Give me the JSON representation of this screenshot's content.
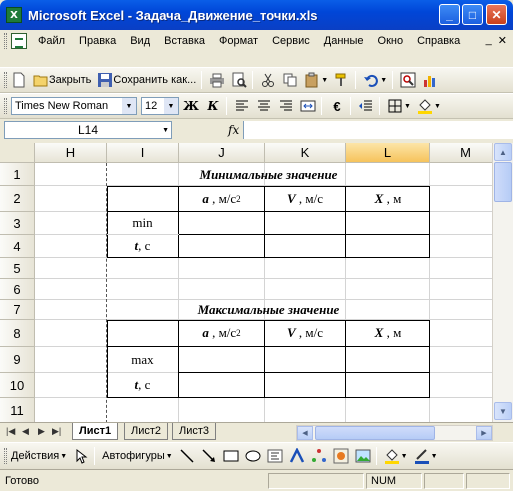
{
  "window": {
    "title": "Microsoft Excel - Задача_Движение_точки.xls",
    "app_icon_letter": "X",
    "minimize": "_",
    "maximize": "□",
    "close": "✕"
  },
  "menu": {
    "items": [
      "Файл",
      "Правка",
      "Вид",
      "Вставка",
      "Формат",
      "Сервис",
      "Данные",
      "Окно",
      "Справка"
    ],
    "doc_minimize": "_",
    "doc_close": "✕"
  },
  "toolbar_standard": {
    "close_label": "Закрыть",
    "save_as_label": "Сохранить как..."
  },
  "toolbar_format": {
    "font": "Times New Roman",
    "size": "12",
    "bold": "Ж",
    "italic": "К",
    "currency": "€"
  },
  "formula_bar": {
    "name_box": "L14",
    "fx": "fx",
    "value": ""
  },
  "sheet": {
    "columns": [
      "H",
      "I",
      "J",
      "K",
      "L",
      "M"
    ],
    "selected_column": "L",
    "rows": [
      "1",
      "2",
      "3",
      "4",
      "5",
      "6",
      "7",
      "8",
      "9",
      "10",
      "11"
    ],
    "block1_title": "Минимальные  значение",
    "block2_title": "Максимальные значение",
    "hdr_a": "a",
    "hdr_a_unit": ", м/с",
    "hdr_a_pow": "2",
    "hdr_v": "V",
    "hdr_v_unit": ", м/с",
    "hdr_x": "X",
    "hdr_x_unit": ", м",
    "label_min": "min",
    "label_max": "max",
    "label_t": "t",
    "label_t_unit": ", с"
  },
  "tabs": {
    "sheets": [
      "Лист1",
      "Лист2",
      "Лист3"
    ],
    "active": "Лист1"
  },
  "drawing_toolbar": {
    "actions_label": "Действия",
    "autoshapes_label": "Автофигуры"
  },
  "status": {
    "text": "Готово",
    "num": "NUM"
  }
}
